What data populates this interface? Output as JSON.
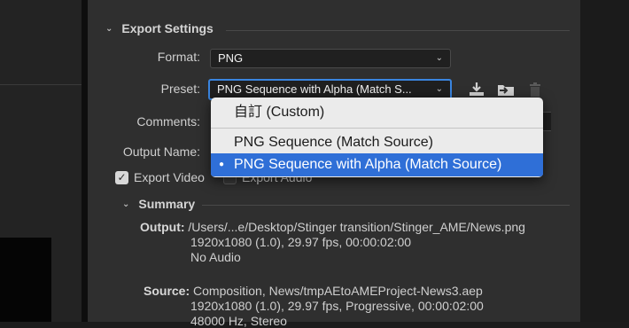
{
  "export_settings": {
    "title": "Export Settings",
    "format": {
      "label": "Format:",
      "value": "PNG"
    },
    "preset": {
      "label": "Preset:",
      "value": "PNG Sequence with Alpha (Match S..."
    },
    "comments": {
      "label": "Comments:"
    },
    "output_name": {
      "label": "Output Name:"
    },
    "export_video": {
      "label": "Export Video",
      "checked": true
    },
    "export_audio": {
      "label": "Export Audio",
      "checked": false
    }
  },
  "preset_menu": {
    "options": [
      {
        "label": "自訂 (Custom)",
        "selected": false
      },
      {
        "label": "PNG Sequence (Match Source)",
        "selected": false
      },
      {
        "label": "PNG Sequence with Alpha (Match Source)",
        "selected": true
      }
    ]
  },
  "summary": {
    "title": "Summary",
    "output": {
      "key": "Output:",
      "line1": "/Users/...e/Desktop/Stinger transition/Stinger_AME/News.png",
      "line2": "1920x1080 (1.0), 29.97 fps, 00:00:02:00",
      "line3": "No Audio"
    },
    "source": {
      "key": "Source:",
      "line1": "Composition, News/tmpAEtoAMEProject-News3.aep",
      "line2": "1920x1080 (1.0), 29.97 fps, Progressive, 00:00:02:00",
      "line3": "48000 Hz, Stereo"
    }
  },
  "icons": {
    "save_preset": "download-icon",
    "import_preset": "folder-import-icon",
    "delete_preset": "trash-icon"
  },
  "colors": {
    "accent": "#2f6fd7",
    "panel": "#2f2f2f",
    "focus_ring": "#3a85e0"
  }
}
